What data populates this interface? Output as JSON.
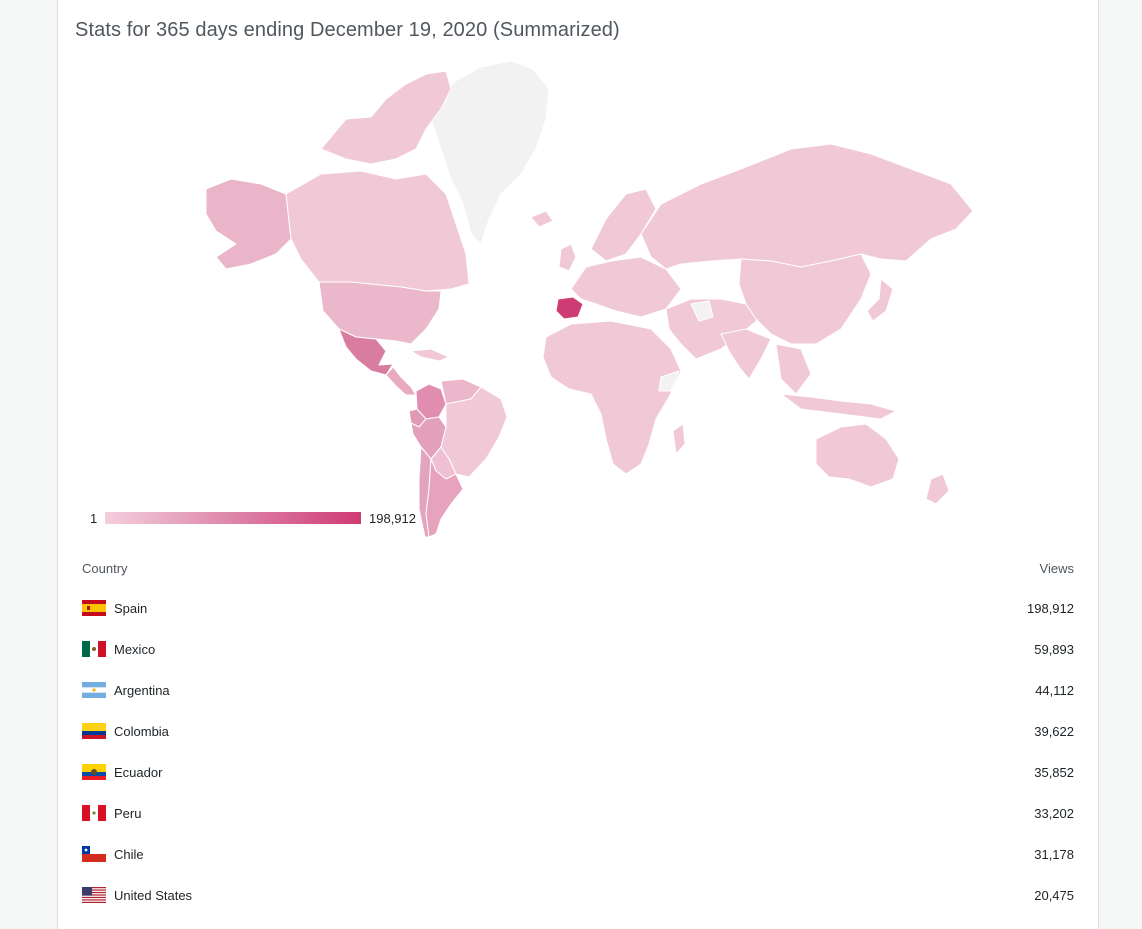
{
  "title": "Stats for 365 days ending December 19, 2020 (Summarized)",
  "legend": {
    "min": "1",
    "max": "198,912",
    "colors": [
      "#f4cfdd",
      "#cf3b73"
    ]
  },
  "table": {
    "header_country": "Country",
    "header_views": "Views",
    "rows": [
      {
        "country": "Spain",
        "views": "198,912",
        "flag": "spain-flag-icon"
      },
      {
        "country": "Mexico",
        "views": "59,893",
        "flag": "mexico-flag-icon"
      },
      {
        "country": "Argentina",
        "views": "44,112",
        "flag": "argentina-flag-icon"
      },
      {
        "country": "Colombia",
        "views": "39,622",
        "flag": "colombia-flag-icon"
      },
      {
        "country": "Ecuador",
        "views": "35,852",
        "flag": "ecuador-flag-icon"
      },
      {
        "country": "Peru",
        "views": "33,202",
        "flag": "peru-flag-icon"
      },
      {
        "country": "Chile",
        "views": "31,178",
        "flag": "chile-flag-icon"
      },
      {
        "country": "United States",
        "views": "20,475",
        "flag": "united-states-flag-icon"
      }
    ]
  },
  "colors": {
    "base": "#f1c8d6",
    "mid": "#e9a9c1",
    "high": "#d4598a",
    "top": "#cf3b73",
    "no_data": "#f2f2f2"
  }
}
